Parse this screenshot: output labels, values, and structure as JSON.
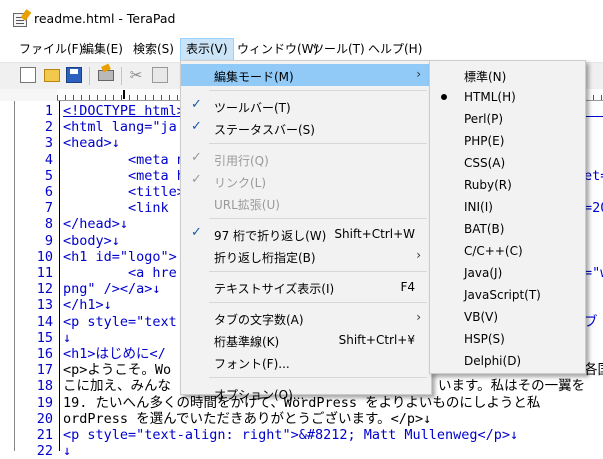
{
  "window": {
    "title": "readme.html - TeraPad"
  },
  "menubar": [
    {
      "label": "ファイル(F)"
    },
    {
      "label": "編集(E)"
    },
    {
      "label": "検索(S)"
    },
    {
      "label": "表示(V)"
    },
    {
      "label": "ウィンドウ(W)"
    },
    {
      "label": "ツール(T)"
    },
    {
      "label": "ヘルプ(H)"
    }
  ],
  "toolbar": {
    "icons": [
      "new-file-icon",
      "open-folder-icon",
      "save-icon",
      "print-icon",
      "cut-icon",
      "copy-icon"
    ]
  },
  "editor": {
    "line_numbers": [
      "1",
      "2",
      "3",
      "4",
      "5",
      "6",
      "7",
      "8",
      "9",
      "10",
      "11",
      "12",
      "13",
      "14",
      "15",
      "16",
      "17",
      "18",
      "19",
      "20",
      "21",
      "22"
    ],
    "lines": [
      "<!DOCTYPE html>",
      "<html lang=\"ja",
      "<head>↓",
      "        <meta n",
      "        <meta h",
      "        <title>",
      "        <link",
      "</head>↓",
      "<body>↓",
      "<h1 id=\"logo\">",
      "        <a hre",
      "png\" /></a>↓",
      "</h1>↓",
      "<p style=\"text",
      "↓",
      "<h1>はじめに</",
      "<p>ようこそ。Wo",
      "こに加え、みんな",
      "19. たいへん多くの時間をかけて、WordPress をよりよいものにしようと私",
      "ordPress を選んでいただきありがとうございます。</p>↓",
      "<p style=\"text-align: right\">&#8212; Matt Mullenweg</p>↓",
      "↓"
    ],
    "right_fragments": [
      {
        "line": 5,
        "text": "et="
      },
      {
        "line": 7,
        "text": "=20"
      },
      {
        "line": 11,
        "text": "=\"w"
      },
      {
        "line": 14,
        "text": "ブ"
      },
      {
        "line": 17,
        "text": "各国"
      },
      {
        "line": 18,
        "text": "います。私はその一翼を"
      }
    ]
  },
  "view_menu": {
    "items": [
      {
        "label": "編集モード(M)",
        "submenu": true,
        "hover": true
      },
      {
        "sep": true
      },
      {
        "label": "ツールバー(T)",
        "checked": true
      },
      {
        "label": "ステータスバー(S)",
        "checked": true
      },
      {
        "sep": true
      },
      {
        "label": "引用行(Q)",
        "checked": true,
        "disabled": true
      },
      {
        "label": "リンク(L)",
        "checked": true,
        "disabled": true
      },
      {
        "label": "URL拡張(U)",
        "disabled": true
      },
      {
        "sep": true
      },
      {
        "label": "97 桁で折り返し(W)",
        "checked": true,
        "shortcut": "Shift+Ctrl+W"
      },
      {
        "label": "折り返し桁指定(B)",
        "submenu": true
      },
      {
        "sep": true
      },
      {
        "label": "テキストサイズ表示(I)",
        "shortcut": "F4"
      },
      {
        "sep": true
      },
      {
        "label": "タブの文字数(A)",
        "submenu": true
      },
      {
        "label": "桁基準線(K)",
        "shortcut": "Shift+Ctrl+¥"
      },
      {
        "label": "フォント(F)..."
      },
      {
        "sep": true
      },
      {
        "label": "オプション(O)..."
      }
    ]
  },
  "edit_mode_submenu": {
    "items": [
      {
        "label": "標準(N)"
      },
      {
        "label": "HTML(H)",
        "selected": true
      },
      {
        "label": "Perl(P)"
      },
      {
        "label": "PHP(E)"
      },
      {
        "label": "CSS(A)"
      },
      {
        "label": "Ruby(R)"
      },
      {
        "label": "INI(I)"
      },
      {
        "label": "BAT(B)"
      },
      {
        "label": "C/C++(C)"
      },
      {
        "label": "Java(J)"
      },
      {
        "label": "JavaScript(T)"
      },
      {
        "label": "VB(V)"
      },
      {
        "label": "HSP(S)"
      },
      {
        "label": "Delphi(D)"
      }
    ]
  },
  "colors": {
    "code": "#0000cc",
    "menu_hover": "#91c9f7",
    "menubar_active": "#cce4f7"
  }
}
